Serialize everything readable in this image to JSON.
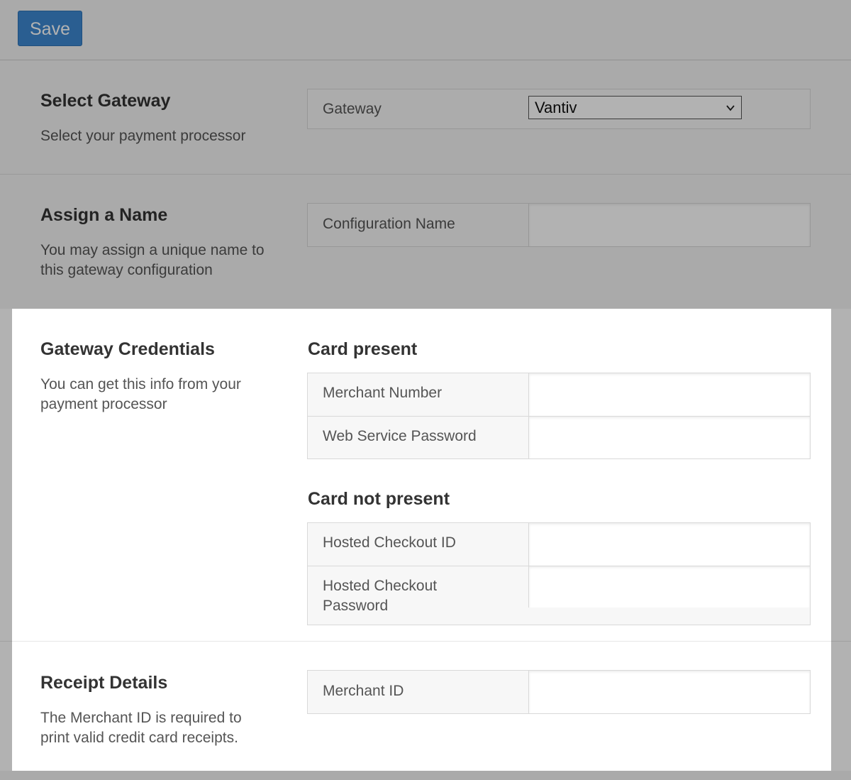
{
  "toolbar": {
    "save_label": "Save"
  },
  "gateway_section": {
    "title": "Select Gateway",
    "description": "Select your payment processor",
    "field_label": "Gateway",
    "selected_value": "Vantiv"
  },
  "name_section": {
    "title": "Assign a Name",
    "description": "You may assign a unique name to this gateway configuration",
    "field_label": "Configuration Name",
    "field_value": ""
  },
  "credentials_section": {
    "title": "Gateway Credentials",
    "description": "You can get this info from your payment processor",
    "card_present": {
      "title": "Card present",
      "fields": [
        {
          "label": "Merchant Number",
          "value": ""
        },
        {
          "label": "Web Service Password",
          "value": ""
        }
      ]
    },
    "card_not_present": {
      "title": "Card not present",
      "fields": [
        {
          "label": "Hosted Checkout ID",
          "value": ""
        },
        {
          "label": "Hosted Checkout Password",
          "value": ""
        }
      ]
    }
  },
  "receipt_section": {
    "title": "Receipt Details",
    "description": "The Merchant ID is required to print valid credit card receipts.",
    "field_label": "Merchant ID",
    "field_value": ""
  },
  "icons": {
    "select_arrow": "chevron-down-icon"
  }
}
